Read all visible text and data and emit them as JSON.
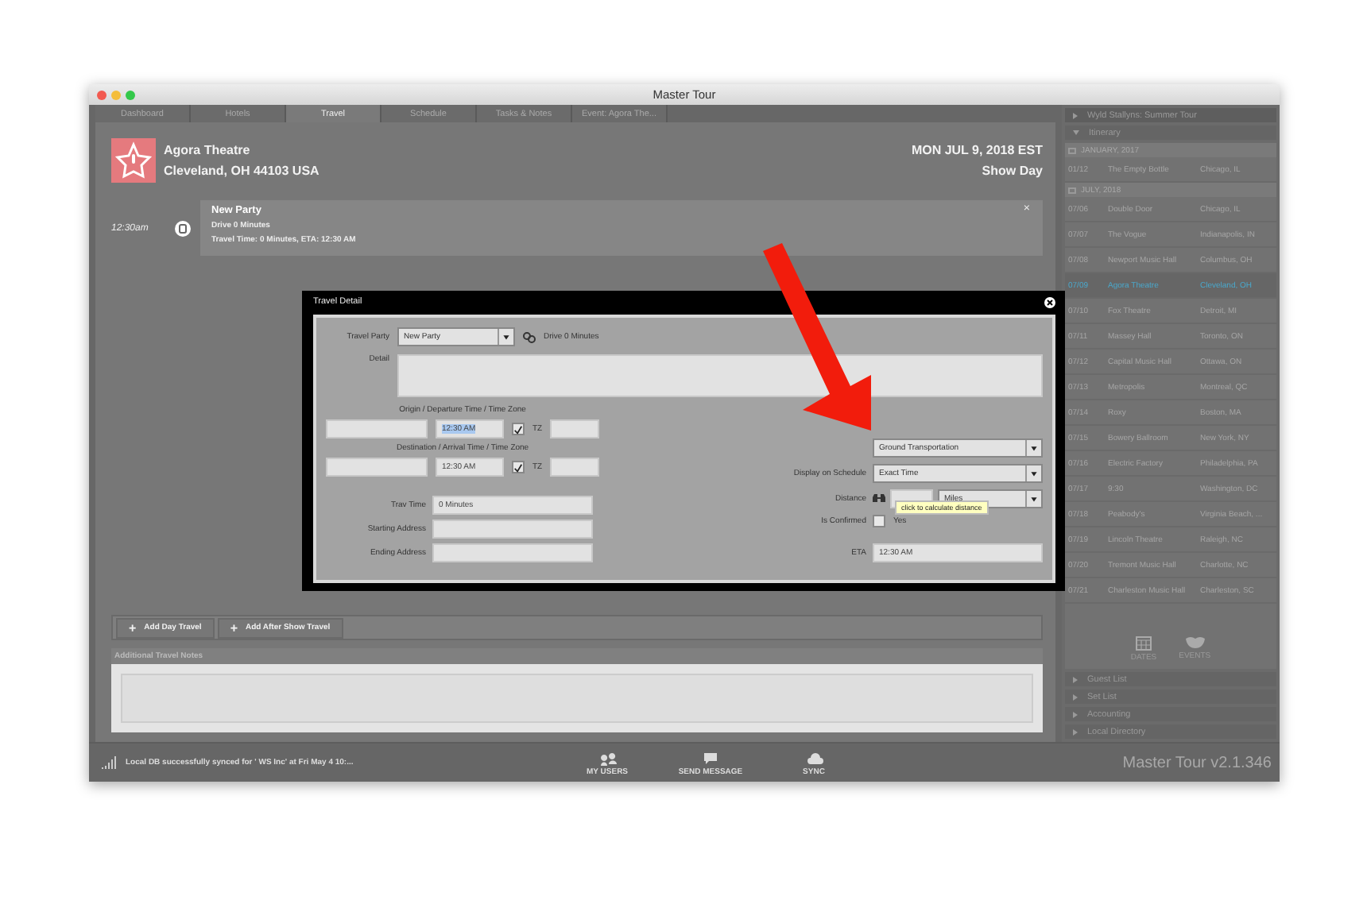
{
  "window": {
    "title": "Master Tour"
  },
  "tabs": [
    {
      "label": "Dashboard",
      "selected": false
    },
    {
      "label": "Hotels",
      "selected": false
    },
    {
      "label": "Travel",
      "selected": true
    },
    {
      "label": "Schedule",
      "selected": false
    },
    {
      "label": "Tasks & Notes",
      "selected": false
    },
    {
      "label": "Event: Agora The...",
      "selected": false
    }
  ],
  "venue": {
    "name": "Agora Theatre",
    "address": "Cleveland, OH 44103 USA",
    "date": "MON JUL 9, 2018 EST",
    "day_type": "Show Day"
  },
  "travel_item": {
    "time": "12:30am",
    "title": "New Party",
    "drive": "Drive 0 Minutes",
    "travel_time": "Travel Time: 0 Minutes, ETA: 12:30 AM",
    "close": "×"
  },
  "actions": [
    {
      "icon": "+",
      "label": "Add Day Travel"
    },
    {
      "icon": "+",
      "label": "Add After Show Travel"
    }
  ],
  "notes": {
    "title": "Additional Travel Notes"
  },
  "dialog": {
    "title": "Travel Detail",
    "travel_party": {
      "label": "Travel Party",
      "value": "New Party",
      "drive": "Drive 0 Minutes"
    },
    "detail": {
      "label": "Detail"
    },
    "origin": {
      "label": "Origin / Departure Time / Time Zone",
      "time": "12:30 AM",
      "checked": true,
      "tz_label": "TZ"
    },
    "destination": {
      "label": "Destination / Arrival Time / Time Zone",
      "time": "12:30 AM",
      "checked": true,
      "tz_label": "TZ"
    },
    "trav_time": {
      "label": "Trav Time",
      "value": "0 Minutes"
    },
    "starting_address": {
      "label": "Starting Address"
    },
    "ending_address": {
      "label": "Ending Address"
    },
    "type": {
      "value": "Ground Transportation"
    },
    "display_on_schedule": {
      "label": "Display on Schedule",
      "value": "Exact Time"
    },
    "distance": {
      "label": "Distance",
      "unit": "Miles"
    },
    "confirmed": {
      "label": "Is Confirmed",
      "option": "Yes",
      "checked": false
    },
    "tooltip": "click to calculate distance",
    "eta": {
      "label": "ETA",
      "value": "12:30 AM"
    }
  },
  "sidebar": {
    "tour": "Wyld Stallyns: Summer Tour",
    "itinerary": "Itinerary",
    "groups": [
      {
        "month": "JANUARY, 2017",
        "rows": [
          {
            "date": "01/12",
            "venue": "The Empty Bottle",
            "city": "Chicago, IL",
            "selected": false
          }
        ]
      },
      {
        "month": "JULY, 2018",
        "rows": [
          {
            "date": "07/06",
            "venue": "Double Door",
            "city": "Chicago, IL",
            "selected": false
          },
          {
            "date": "07/07",
            "venue": "The Vogue",
            "city": "Indianapolis, IN",
            "selected": false
          },
          {
            "date": "07/08",
            "venue": "Newport Music Hall",
            "city": "Columbus, OH",
            "selected": false
          },
          {
            "date": "07/09",
            "venue": "Agora Theatre",
            "city": "Cleveland, OH",
            "selected": true
          },
          {
            "date": "07/10",
            "venue": "Fox Theatre",
            "city": "Detroit, MI",
            "selected": false
          },
          {
            "date": "07/11",
            "venue": "Massey Hall",
            "city": "Toronto, ON",
            "selected": false
          },
          {
            "date": "07/12",
            "venue": "Capital Music Hall",
            "city": "Ottawa, ON",
            "selected": false
          },
          {
            "date": "07/13",
            "venue": "Metropolis",
            "city": "Montreal, QC",
            "selected": false
          },
          {
            "date": "07/14",
            "venue": "Roxy",
            "city": "Boston, MA",
            "selected": false
          },
          {
            "date": "07/15",
            "venue": "Bowery Ballroom",
            "city": "New York, NY",
            "selected": false
          },
          {
            "date": "07/16",
            "venue": "Electric Factory",
            "city": "Philadelphia, PA",
            "selected": false
          },
          {
            "date": "07/17",
            "venue": "9:30",
            "city": "Washington, DC",
            "selected": false
          },
          {
            "date": "07/18",
            "venue": "Peabody's",
            "city": "Virginia Beach, ...",
            "selected": false
          },
          {
            "date": "07/19",
            "venue": "Lincoln Theatre",
            "city": "Raleigh, NC",
            "selected": false
          },
          {
            "date": "07/20",
            "venue": "Tremont Music Hall",
            "city": "Charlotte, NC",
            "selected": false
          },
          {
            "date": "07/21",
            "venue": "Charleston Music Hall",
            "city": "Charleston, SC",
            "selected": false
          }
        ]
      }
    ],
    "views": [
      {
        "label": "DATES",
        "kind": "calendar"
      },
      {
        "label": "EVENTS",
        "kind": "mask"
      }
    ],
    "sections": [
      "Guest List",
      "Set List",
      "Accounting",
      "Local Directory"
    ],
    "version": "Master Tour v2.1.346"
  },
  "status_bar": {
    "message": "Local DB successfully synced for ' WS Inc' at Fri May 4 10:...",
    "buttons": [
      {
        "label": "MY USERS",
        "kind": "users"
      },
      {
        "label": "SEND MESSAGE",
        "kind": "chat"
      },
      {
        "label": "SYNC",
        "kind": "cloud"
      }
    ]
  }
}
